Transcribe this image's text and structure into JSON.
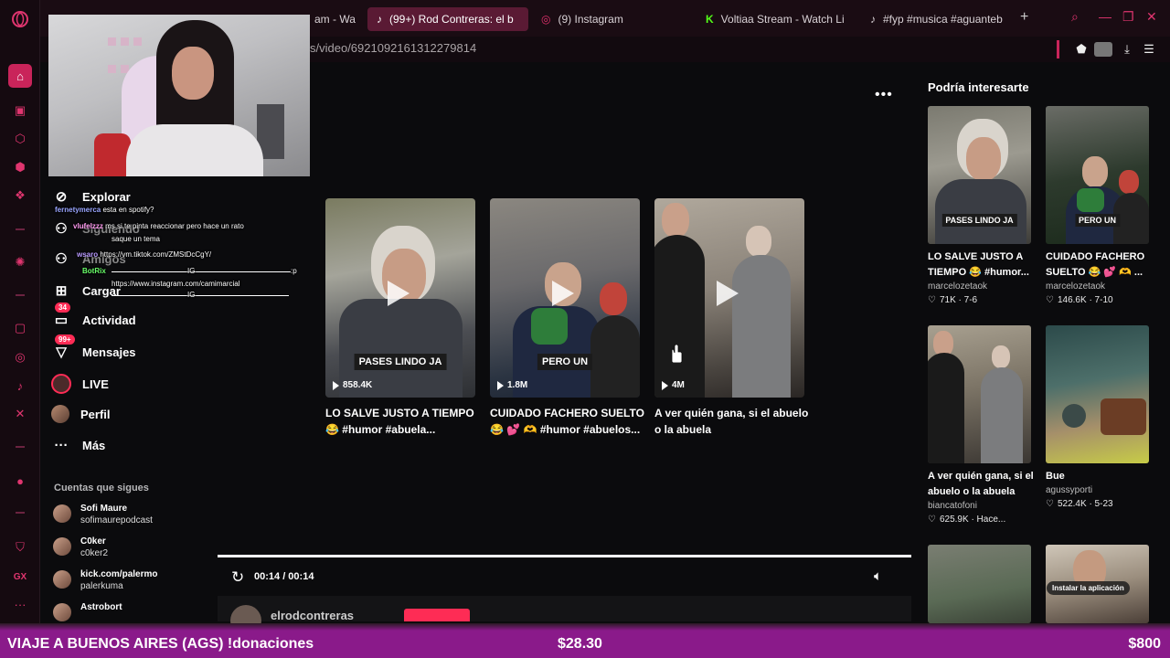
{
  "browser": {
    "tabs": [
      {
        "label": "am - Wa",
        "icon": "twitch-icon"
      },
      {
        "label": "(99+) Rod Contreras: el b",
        "icon": "tiktok-icon"
      },
      {
        "label": "(9) Instagram",
        "icon": "instagram-icon"
      },
      {
        "label": "Voltiaa Stream - Watch Li",
        "icon": "kick-icon"
      },
      {
        "label": "#fyp #musica #aguanteb",
        "icon": "tiktok-icon"
      }
    ],
    "new_tab": "+",
    "address": "s/video/6921092161312279814"
  },
  "nav": {
    "explore": "Explorar",
    "following": "Siguiendo",
    "friends": "Amigos",
    "upload": "Cargar",
    "activity": "Actividad",
    "activity_badge": "34",
    "messages": "Mensajes",
    "messages_badge": "99+",
    "live": "LIVE",
    "profile": "Perfil",
    "more": "Más"
  },
  "chat": {
    "lines": [
      {
        "user": "fernetymerca",
        "text": " esta en spotify?"
      },
      {
        "user": "vlufelzzz",
        "text": " ms si te pinta reaccionar pero hace un rato"
      },
      {
        "user": "",
        "text": "saque un tema"
      },
      {
        "user": "wsaro",
        "text": " https://vm.tiktok.com/ZMStDcCgY/"
      },
      {
        "user": "BotRix",
        "text": ""
      },
      {
        "user": "",
        "text": "IG"
      },
      {
        "user": "",
        "text": ":p"
      },
      {
        "user": "",
        "text": "https://www.instagram.com/camimarcial"
      },
      {
        "user": "",
        "text": "IG"
      }
    ]
  },
  "following_section": {
    "title": "Cuentas que sigues",
    "accounts": [
      {
        "name": "Sofi Maure",
        "user": "sofimaurepodcast"
      },
      {
        "name": "C0ker",
        "user": "c0ker2"
      },
      {
        "name": "kick.com/palermo",
        "user": "palerkuma"
      },
      {
        "name": "Astrobort",
        "user": ""
      }
    ]
  },
  "videos": [
    {
      "caption": "PASES LINDO JA",
      "views": "858.4K",
      "title": "LO SALVE JUSTO A TIEMPO 😂 #humor #abuela..."
    },
    {
      "caption": "PERO UN",
      "views": "1.8M",
      "title": "CUIDADO FACHERO SUELTO 😂 💕 🫶 #humor #abuelos..."
    },
    {
      "caption": "",
      "views": "4M",
      "title": "A ver quién gana, si el abuelo o la abuela"
    }
  ],
  "player": {
    "time": "00:14 / 00:14",
    "progress": 1.0,
    "author": "elrodcontreras"
  },
  "recommendations": {
    "title": "Podría interesarte",
    "items": [
      {
        "caption": "PASES LINDO JA",
        "title": "LO SALVE JUSTO A TIEMPO 😂 #humor...",
        "user": "marcelozetaok",
        "stats": "71K · 7-6"
      },
      {
        "caption": "PERO UN",
        "title": "CUIDADO FACHERO SUELTO 😂 💕 🫶 ...",
        "user": "marcelozetaok",
        "stats": "146.6K · 7-10"
      },
      {
        "caption": "",
        "title": "A ver quién gana, si el abuelo o la abuela",
        "user": "biancatofoni",
        "stats": "625.9K · Hace..."
      },
      {
        "caption": "",
        "title": "Bue",
        "user": "agussyporti",
        "stats": "522.4K · 5-23"
      }
    ],
    "install_label": "Instalar la aplicación"
  },
  "ticker": {
    "left": "VIAJE A BUENOS AIRES (AGS) !donaciones",
    "mid": "$28.30",
    "right": "$800"
  },
  "colors": {
    "accent": "#fe2c55",
    "browser_accent": "#e0356f",
    "ticker_bg": "#8a1a8a"
  }
}
